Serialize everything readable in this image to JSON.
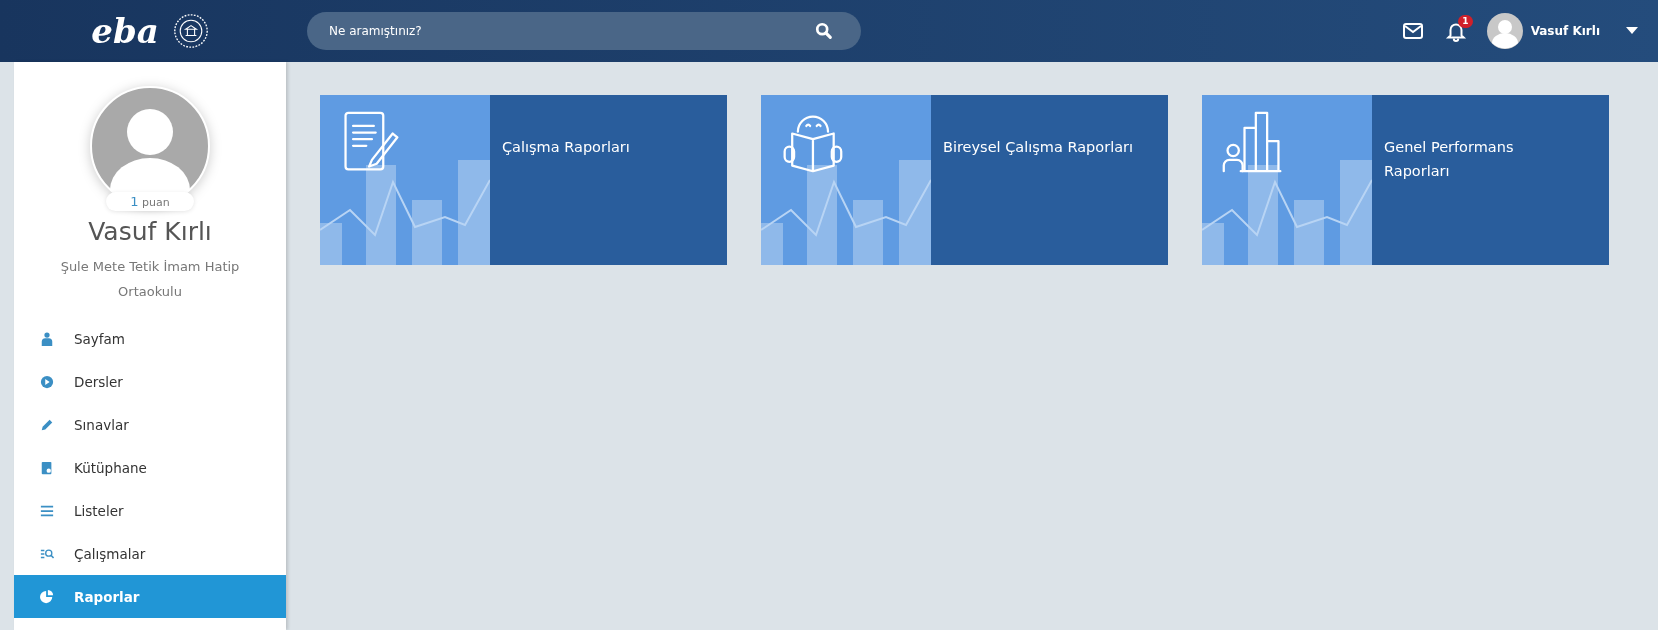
{
  "header": {
    "logo": "eba",
    "search": {
      "placeholder": "Ne aramıştınız?"
    },
    "notifications": {
      "count": "1"
    },
    "user": {
      "name": "Vasuf Kırlı"
    }
  },
  "profile": {
    "points": "1",
    "points_label": "puan",
    "name": "Vasuf Kırlı",
    "school": "Şule Mete Tetik İmam Hatip Ortaokulu"
  },
  "sidebar": {
    "items": [
      {
        "label": "Sayfam",
        "selected": false
      },
      {
        "label": "Dersler",
        "selected": false
      },
      {
        "label": "Sınavlar",
        "selected": false
      },
      {
        "label": "Kütüphane",
        "selected": false
      },
      {
        "label": "Listeler",
        "selected": false
      },
      {
        "label": "Çalışmalar",
        "selected": false
      },
      {
        "label": "Raporlar",
        "selected": true
      }
    ]
  },
  "cards": [
    {
      "title": "Çalışma Raporları"
    },
    {
      "title": "Bireysel Çalışma Raporları"
    },
    {
      "title": "Genel Performans Raporları"
    }
  ]
}
